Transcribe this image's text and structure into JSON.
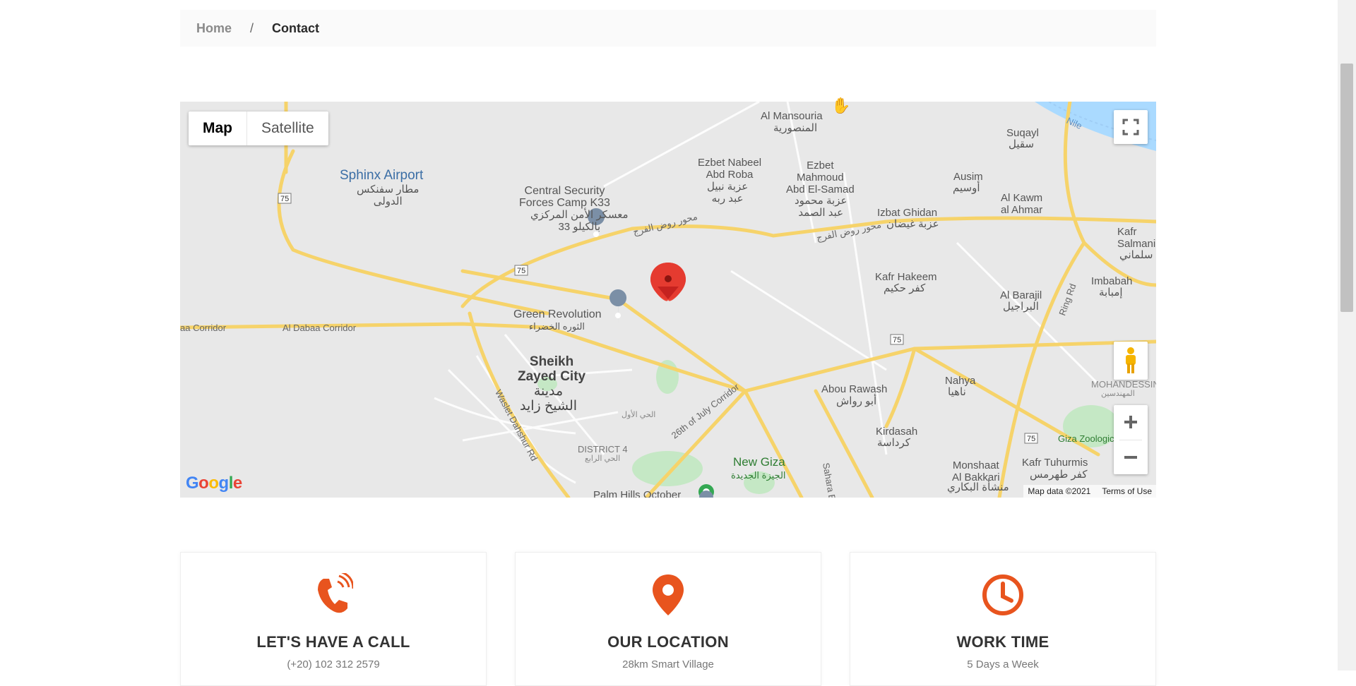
{
  "breadcrumb": {
    "home": "Home",
    "separator": "/",
    "current": "Contact"
  },
  "map": {
    "type_controls": {
      "map": "Map",
      "satellite": "Satellite"
    },
    "labels": {
      "sphinx_airport": "Sphinx Airport",
      "sphinx_airport_ar": "مطار سفنكس\nالدولى",
      "central_security": "Central Security\nForces Camp K33",
      "central_security_ar": "معسكر الأمن المركزي\nبالكيلو 33",
      "al_mansouria": "Al Mansouria",
      "al_mansouria_ar": "المنصورية",
      "ezbet_nabeel": "Ezbet Nabeel\nAbd Roba",
      "ezbet_nabeel_ar": "عزبة نبيل\nعبد ربه",
      "ezbet_mahmoud": "Ezbet\nMahmoud\nAbd El-Samad",
      "ezbet_mahmoud_ar": "عزبة محمود\nعبد الصمد",
      "suqayl": "Suqayl",
      "suqayl_ar": "سقيل",
      "ausim": "Ausim",
      "ausim_ar": "أوسيم",
      "al_kawm": "Al Kawm\nal Ahmar",
      "izbat_ghidan": "Izbat Ghidan",
      "izbat_ghidan_ar": "عزبة غيضان",
      "kafr_salmani": "Kafr\nSalmani",
      "kafr_salmani_ar": "سلماني",
      "kafr_hakeem": "Kafr Hakeem",
      "kafr_hakeem_ar": "كفر حكيم",
      "al_barajil": "Al Barajil",
      "al_barajil_ar": "البراجيل",
      "imbabah": "Imbabah",
      "imbabah_ar": "إمبابة",
      "green_revolution": "Green Revolution",
      "green_revolution_ar": "الثوره الخضراء",
      "sheikh_zayed": "Sheikh\nZayed City",
      "sheikh_zayed_ar": "مدينة\nالشيخ زايد",
      "al_dabaa": "Al Dabaa Corridor",
      "dabaa_left": "aa Corridor",
      "abou_rawash": "Abou Rawash",
      "abou_rawash_ar": "أبو رواش",
      "nahya": "Nahya",
      "nahya_ar": "ناهيا",
      "mohandessin": "MOHANDESSIN",
      "mohandessin_ar": "المهندسين",
      "kirdasah": "Kirdasah",
      "kirdasah_ar": "كرداسة",
      "district4": "DISTRICT 4",
      "district4_ar": "الحي الرابع",
      "first_district_ar": "الحي الأول",
      "new_giza": "New Giza",
      "new_giza_ar": "الجيزة الجديدة",
      "palm_hills": "Palm Hills October",
      "monshaat": "Monshaat\nAl Bakkari",
      "monshaat_ar": "منشأة البكاري",
      "kafr_tuhurmis": "Kafr Tuhurmis",
      "kafr_tuhurmis_ar": "كفر طهرمس",
      "giza_zoo": "Giza Zoologic",
      "wasle_dahshur": "Waslet Dahshur Rd",
      "july_corridor": "26th of July Corridor",
      "rawd_farag": "محور روض الفرج",
      "ring_rd": "Ring Rd",
      "sahara": "Sahara E",
      "nile": "Nile",
      "route75": "75"
    },
    "google": "Google",
    "attribution": {
      "data": "Map data ©2021",
      "terms": "Terms of Use"
    }
  },
  "cards": [
    {
      "title": "LET'S HAVE A CALL",
      "subtitle": "(+20) 102 312 2579",
      "icon": "phone-icon"
    },
    {
      "title": "OUR LOCATION",
      "subtitle": "28km Smart Village",
      "icon": "location-pin-icon"
    },
    {
      "title": "WORK TIME",
      "subtitle": "5 Days a Week",
      "icon": "clock-icon"
    }
  ],
  "colors": {
    "accent": "#e8541e",
    "road": "#f6d36a",
    "map_bg": "#e8e8e8",
    "water": "#aadaff",
    "park": "#c5e8c5"
  }
}
